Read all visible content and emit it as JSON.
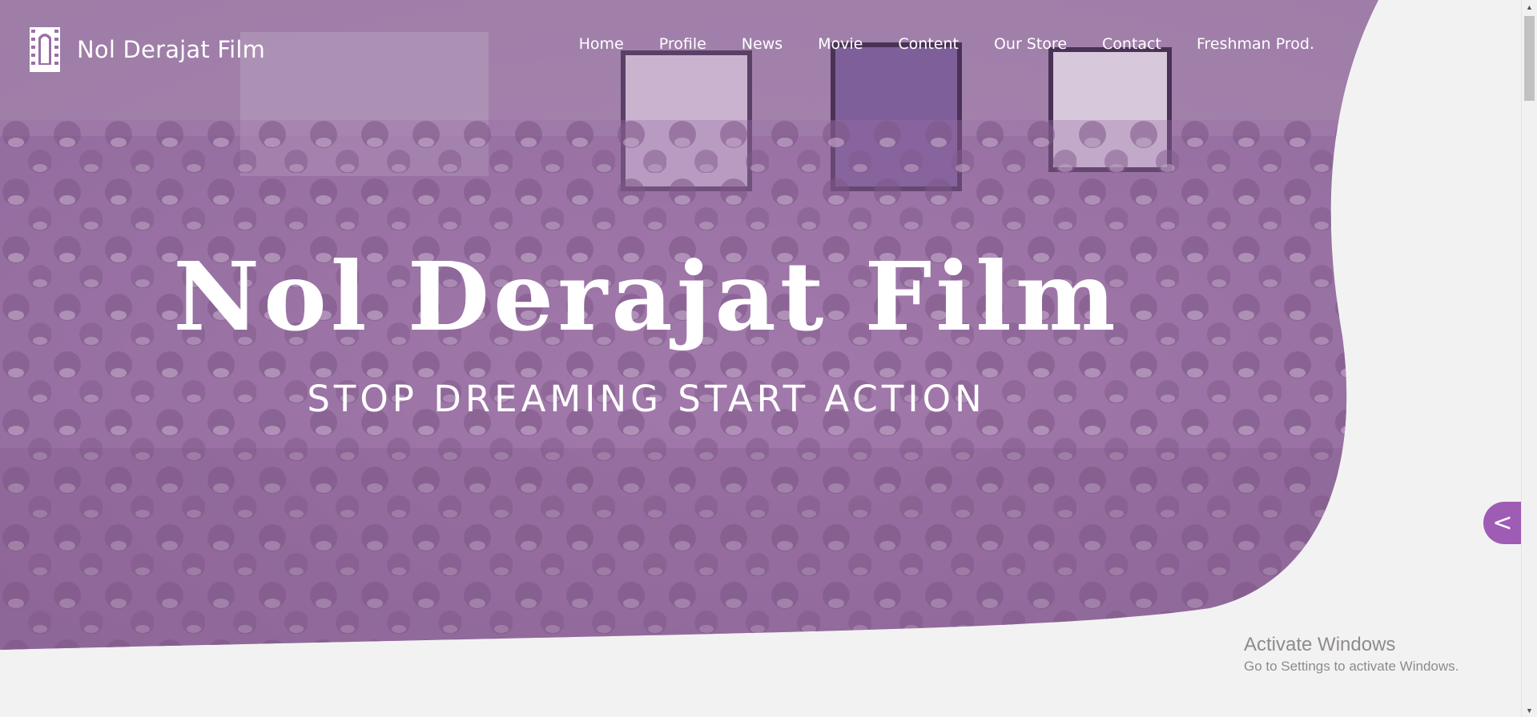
{
  "brand": {
    "logo_icon": "film-strip-logo-icon",
    "name": "Nol Derajat Film"
  },
  "nav": {
    "items": [
      {
        "label": "Home"
      },
      {
        "label": "Profile"
      },
      {
        "label": "News"
      },
      {
        "label": "Movie"
      },
      {
        "label": "Content"
      },
      {
        "label": "Our Store"
      },
      {
        "label": "Contact"
      },
      {
        "label": "Freshman Prod."
      }
    ]
  },
  "hero": {
    "title": "Nol Derajat Film",
    "tagline": "STOP DREAMING START ACTION",
    "overlay_color": "#9b6fa6",
    "photo": "group-photo"
  },
  "side_toggle": {
    "label": "<",
    "color": "#9e5cb4"
  },
  "windows_watermark": {
    "title": "Activate Windows",
    "subtitle": "Go to Settings to activate Windows."
  },
  "scrollbar": {
    "up_icon": "chevron-up-icon",
    "down_icon": "chevron-down-icon"
  }
}
